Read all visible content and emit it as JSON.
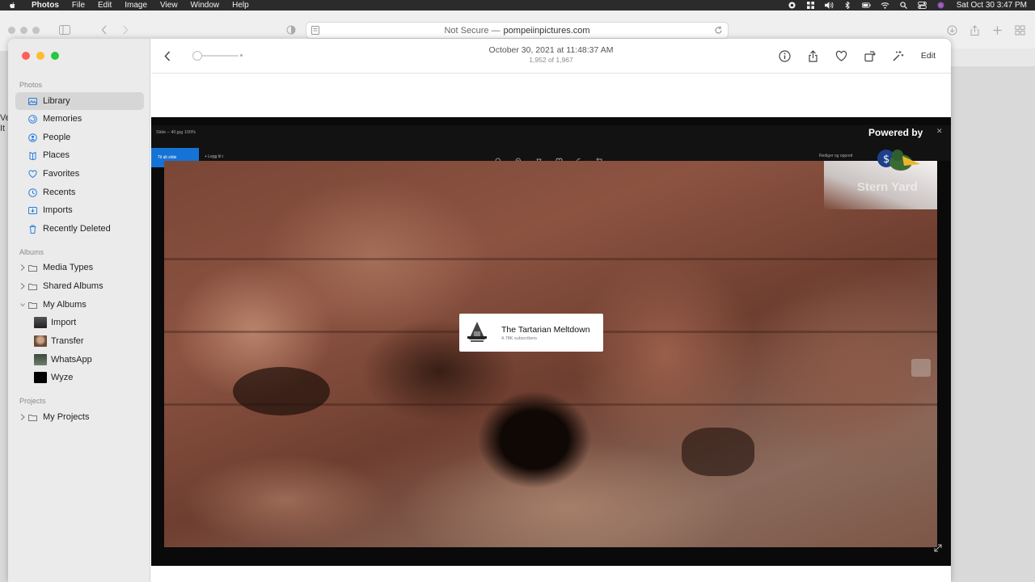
{
  "menubar": {
    "app": "Photos",
    "items": [
      "File",
      "Edit",
      "Image",
      "View",
      "Window",
      "Help"
    ],
    "clock": "Sat Oct 30  3:47 PM"
  },
  "safari": {
    "url_prefix": "Not Secure —",
    "url_domain": "pompeiinpictures.com"
  },
  "background_text": "Ve\nIt",
  "photos": {
    "sidebar": {
      "photos_header": "Photos",
      "items": [
        {
          "label": "Library",
          "icon": "library-icon"
        },
        {
          "label": "Memories",
          "icon": "memories-icon"
        },
        {
          "label": "People",
          "icon": "people-icon"
        },
        {
          "label": "Places",
          "icon": "places-icon"
        },
        {
          "label": "Favorites",
          "icon": "heart-icon"
        },
        {
          "label": "Recents",
          "icon": "clock-icon"
        },
        {
          "label": "Imports",
          "icon": "imports-icon"
        },
        {
          "label": "Recently Deleted",
          "icon": "trash-icon"
        }
      ],
      "albums_header": "Albums",
      "albums": [
        {
          "label": "Media Types"
        },
        {
          "label": "Shared Albums"
        },
        {
          "label": "My Albums"
        }
      ],
      "my_albums": [
        {
          "label": "Import"
        },
        {
          "label": "Transfer"
        },
        {
          "label": "WhatsApp"
        },
        {
          "label": "Wyze"
        }
      ],
      "projects_header": "Projects",
      "projects": [
        {
          "label": "My Projects"
        }
      ]
    },
    "toolbar": {
      "title": "October 30, 2021 at 11:48:37 AM",
      "subtitle": "1,952 of 1,967",
      "edit_label": "Edit"
    },
    "video": {
      "file_label": "Slide – 40.jpg   100%",
      "primary_btn": "Til alt slide",
      "add_label": "+ Legg til i",
      "right_label": "Rediger og opprett",
      "powered_by": "Powered by",
      "watermark": "Stern Yard",
      "card_name": "The Tartarian Meltdown",
      "card_subs": "4.78K subscribers"
    }
  }
}
